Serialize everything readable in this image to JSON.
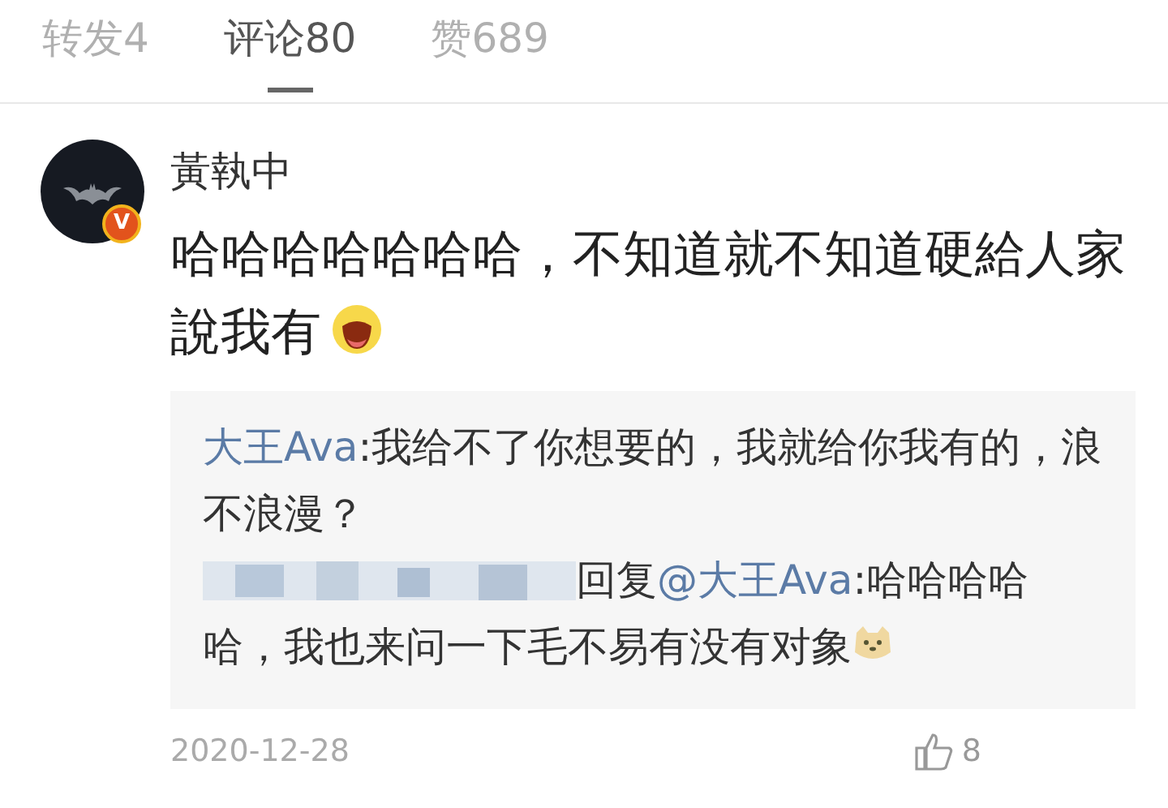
{
  "tabs": [
    {
      "label": "转发4",
      "selected": false
    },
    {
      "label": "评论80",
      "selected": true
    },
    {
      "label": "赞689",
      "selected": false
    }
  ],
  "comment": {
    "author": "黃執中",
    "verified": true,
    "badge": "V",
    "text": "哈哈哈哈哈哈哈，不知道就不知道硬給人家說我有",
    "replies": [
      {
        "kind": "named",
        "author": "大王Ava",
        "separator": ":",
        "text": "我给不了你想要的，我就给你我有的，浪不浪漫？"
      },
      {
        "kind": "hidden",
        "verb": "回复",
        "mention": "@大王Ava",
        "text": ":哈哈哈哈哈，我也来问一下毛不易有没有对象"
      }
    ],
    "date": "2020-12-28",
    "likes": "8"
  }
}
